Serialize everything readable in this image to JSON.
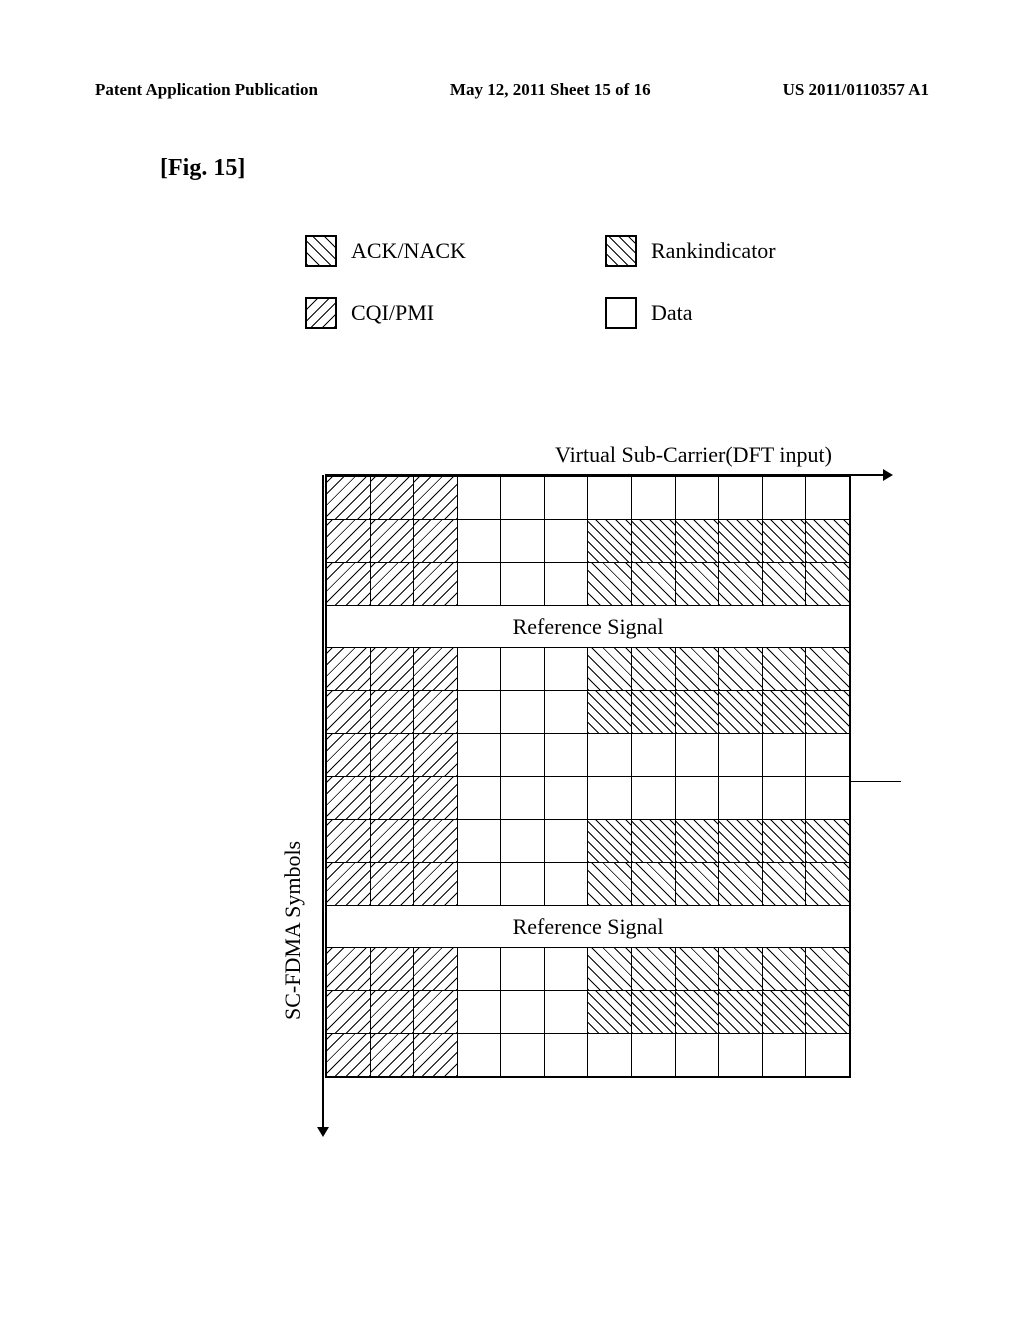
{
  "header": {
    "left": "Patent Application Publication",
    "middle": "May 12, 2011  Sheet 15 of 16",
    "right": "US 2011/0110357 A1"
  },
  "figure": {
    "label": "[Fig. 15]"
  },
  "legend": {
    "ack": "ACK/NACK",
    "rank": "Rankindicator",
    "cqi": "CQI/PMI",
    "data": "Data"
  },
  "axes": {
    "x": "Virtual Sub-Carrier(DFT input)",
    "y": "SC-FDMA Symbols"
  },
  "refsig": "Reference Signal",
  "chart_data": {
    "type": "table",
    "title": "Resource element mapping for control info in SC-FDMA subframe",
    "xlabel": "Virtual Sub-Carrier (DFT input)",
    "ylabel": "SC-FDMA Symbols",
    "cols": 12,
    "rows": 14,
    "cell_types": {
      "C": "CQI/PMI",
      "X": "Rankindicator",
      "D": "Data (blank)",
      "A": "ACK/NACK",
      "R": "Reference Signal"
    },
    "grid": [
      [
        "C",
        "C",
        "C",
        "D",
        "D",
        "D",
        "D",
        "D",
        "D",
        "D",
        "D",
        "D"
      ],
      [
        "C",
        "C",
        "C",
        "D",
        "D",
        "D",
        "X",
        "X",
        "X",
        "X",
        "X",
        "X"
      ],
      [
        "C",
        "C",
        "C",
        "D",
        "D",
        "D",
        "A",
        "A",
        "A",
        "A",
        "A",
        "A"
      ],
      [
        "R",
        "R",
        "R",
        "R",
        "R",
        "R",
        "R",
        "R",
        "R",
        "R",
        "R",
        "R"
      ],
      [
        "C",
        "C",
        "C",
        "D",
        "D",
        "D",
        "A",
        "A",
        "A",
        "A",
        "A",
        "A"
      ],
      [
        "C",
        "C",
        "C",
        "D",
        "D",
        "D",
        "X",
        "X",
        "X",
        "X",
        "X",
        "X"
      ],
      [
        "C",
        "C",
        "C",
        "D",
        "D",
        "D",
        "D",
        "D",
        "D",
        "D",
        "D",
        "D"
      ],
      [
        "C",
        "C",
        "C",
        "D",
        "D",
        "D",
        "D",
        "D",
        "D",
        "D",
        "D",
        "D"
      ],
      [
        "C",
        "C",
        "C",
        "D",
        "D",
        "D",
        "X",
        "X",
        "X",
        "X",
        "X",
        "X"
      ],
      [
        "C",
        "C",
        "C",
        "D",
        "D",
        "D",
        "A",
        "A",
        "A",
        "A",
        "A",
        "A"
      ],
      [
        "R",
        "R",
        "R",
        "R",
        "R",
        "R",
        "R",
        "R",
        "R",
        "R",
        "R",
        "R"
      ],
      [
        "C",
        "C",
        "C",
        "D",
        "D",
        "D",
        "A",
        "A",
        "A",
        "A",
        "A",
        "A"
      ],
      [
        "C",
        "C",
        "C",
        "D",
        "D",
        "D",
        "X",
        "X",
        "X",
        "X",
        "X",
        "X"
      ],
      [
        "C",
        "C",
        "C",
        "D",
        "D",
        "D",
        "D",
        "D",
        "D",
        "D",
        "D",
        "D"
      ]
    ]
  }
}
